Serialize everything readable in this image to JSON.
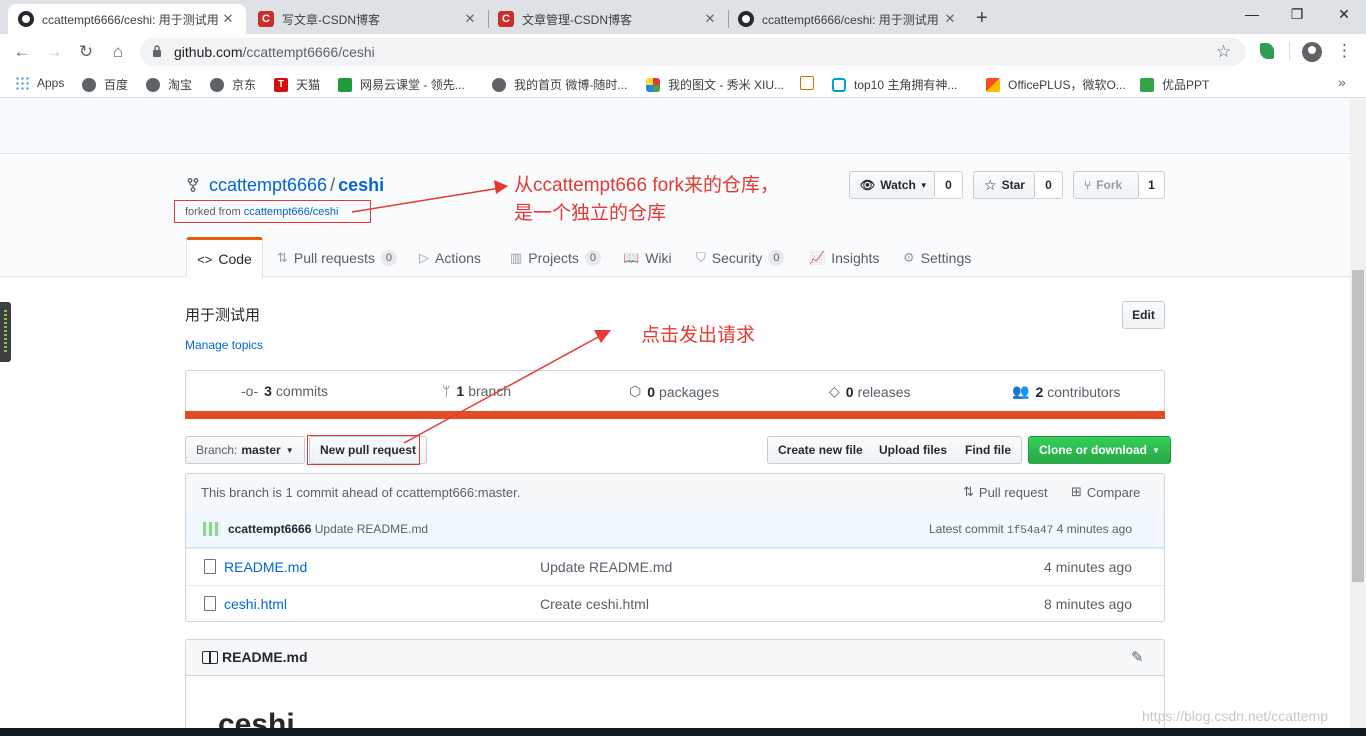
{
  "browser": {
    "tabs": [
      {
        "title": "ccattempt6666/ceshi: 用于测试用",
        "icon": "github-icon",
        "active": true
      },
      {
        "title": "写文章-CSDN博客",
        "icon": "csdn-icon",
        "active": false
      },
      {
        "title": "文章管理-CSDN博客",
        "icon": "csdn-icon",
        "active": false
      },
      {
        "title": "ccattempt6666/ceshi: 用于测试用",
        "icon": "github-icon",
        "active": false
      }
    ],
    "url_host": "github.com",
    "url_path": "/ccattempt6666/ceshi",
    "bookmarks": [
      "Apps",
      "百度",
      "淘宝",
      "京东",
      "天猫",
      "网易云课堂 - 领先...",
      "我的首页 微博-随时...",
      "我的图文 - 秀米 XIU...",
      "top10 主角拥有神...",
      "OfficePLUS，微软O...",
      "优品PPT"
    ]
  },
  "repo": {
    "owner": "ccattempt6666",
    "separator": "/",
    "name": "ceshi",
    "forked_prefix": "forked from",
    "forked_source": "ccattempt666/ceshi",
    "watch_label": "Watch",
    "watch_count": "0",
    "star_label": "Star",
    "star_count": "0",
    "fork_label": "Fork",
    "fork_count": "1"
  },
  "nav": [
    {
      "label": "Code",
      "count": ""
    },
    {
      "label": "Pull requests",
      "count": "0"
    },
    {
      "label": "Actions",
      "count": ""
    },
    {
      "label": "Projects",
      "count": "0"
    },
    {
      "label": "Wiki",
      "count": ""
    },
    {
      "label": "Security",
      "count": "0"
    },
    {
      "label": "Insights",
      "count": ""
    },
    {
      "label": "Settings",
      "count": ""
    }
  ],
  "about": {
    "description": "用于测试用",
    "manage_topics": "Manage topics",
    "edit_label": "Edit"
  },
  "summary": {
    "commits_n": "3",
    "commits_label": "commits",
    "branch_n": "1",
    "branch_label": "branch",
    "packages_n": "0",
    "packages_label": "packages",
    "releases_n": "0",
    "releases_label": "releases",
    "contributors_n": "2",
    "contributors_label": "contributors",
    "language_color": "#e34c26"
  },
  "file_nav": {
    "branch_prefix": "Branch:",
    "branch_name": "master",
    "new_pr": "New pull request",
    "create_file": "Create new file",
    "upload_files": "Upload files",
    "find_file": "Find file",
    "clone": "Clone or download"
  },
  "branch_info": {
    "text": "This branch is 1 commit ahead of ccattempt666:master.",
    "pull_request": "Pull request",
    "compare": "Compare"
  },
  "latest_commit": {
    "author": "ccattempt6666",
    "message": "Update README.md",
    "prefix": "Latest commit",
    "sha": "1f54a47",
    "age": "4 minutes ago"
  },
  "files": [
    {
      "name": "README.md",
      "message": "Update README.md",
      "age": "4 minutes ago"
    },
    {
      "name": "ceshi.html",
      "message": "Create ceshi.html",
      "age": "8 minutes ago"
    }
  ],
  "readme": {
    "title": "README.md",
    "heading": "ceshi"
  },
  "annotations": {
    "fork_note_line1": "从ccattempt666 fork来的仓库，",
    "fork_note_line2": "是一个独立的仓库",
    "click_note": "点击发出请求",
    "color": "#e53935"
  },
  "watermark": "https://blog.csdn.net/ccattemp"
}
